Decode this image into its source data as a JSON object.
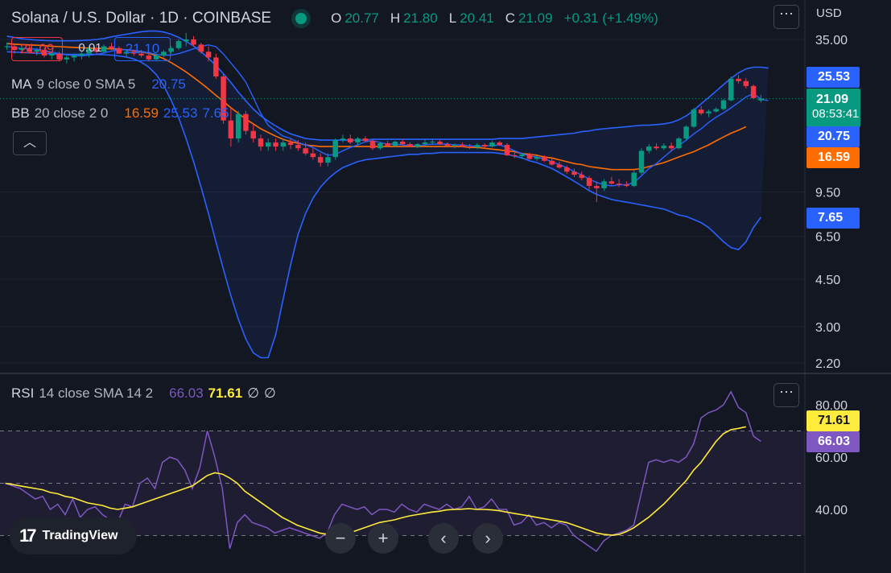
{
  "header": {
    "title": "Solana / U.S. Dollar · 1D · COINBASE",
    "ohlc": [
      {
        "k": "O",
        "v": "20.77"
      },
      {
        "k": "H",
        "v": "21.80"
      },
      {
        "k": "L",
        "v": "20.41"
      },
      {
        "k": "C",
        "v": "21.09"
      }
    ],
    "change": "+0.31 (+1.49%)",
    "currency": "USD"
  },
  "sell_price": "21.09",
  "spread": "0.01",
  "buy_price": "21.10",
  "ma_legend": {
    "name": "MA",
    "params": "9 close 0 SMA 5",
    "value": "20.75"
  },
  "bb_legend": {
    "name": "BB",
    "params": "20 close 2 0",
    "basis": "16.59",
    "upper": "25.53",
    "lower": "7.65"
  },
  "rsi_legend": {
    "name": "RSI",
    "params": "14 close SMA 14 2",
    "rsi": "66.03",
    "sma": "71.61",
    "div1": "∅",
    "div2": "∅"
  },
  "axis_tags": {
    "bb_upper": "25.53",
    "last_price": "21.09",
    "countdown": "08:53:41",
    "ma": "20.75",
    "bb_basis": "16.59",
    "bb_lower": "7.65",
    "rsi_sma": "71.61",
    "rsi": "66.03"
  },
  "branding": "TradingView",
  "icons": {
    "menu": "ellipsis-icon",
    "collapse": "chevron-up-icon",
    "zoom_out": "minus-icon",
    "zoom_in": "plus-icon",
    "scroll_left": "chevron-left-icon",
    "scroll_right": "chevron-right-icon"
  },
  "colors": {
    "up": "#089981",
    "down": "#f23645",
    "ma": "#2962ff",
    "bb_basis": "#ff6d00",
    "bb_band": "#2962ff",
    "rsi": "#7e57c2",
    "rsi_sma": "#ffeb3b"
  },
  "chart_data": [
    {
      "type": "candlestick",
      "title": "Solana / U.S. Dollar · 1D · COINBASE",
      "yscale": "log",
      "yticks": [
        35.0,
        9.5,
        6.5,
        4.5,
        3.0,
        2.2
      ],
      "ylim": [
        2.1,
        40
      ],
      "candles": [
        [
          33,
          34,
          32,
          33
        ],
        [
          33,
          33.5,
          31,
          32
        ],
        [
          32,
          33,
          31,
          32.5
        ],
        [
          32.5,
          33,
          31,
          31.5
        ],
        [
          31.5,
          32.5,
          30.5,
          32
        ],
        [
          32,
          32.5,
          30,
          30.5
        ],
        [
          30.5,
          31.5,
          29.5,
          31
        ],
        [
          31,
          31.5,
          29,
          29.5
        ],
        [
          29.5,
          30.5,
          28.5,
          30
        ],
        [
          30,
          31,
          29,
          30.5
        ],
        [
          30.5,
          31.5,
          29.5,
          31
        ],
        [
          31,
          33,
          30,
          32.5
        ],
        [
          32.5,
          33,
          31,
          31.5
        ],
        [
          31.5,
          33.5,
          31,
          33
        ],
        [
          33,
          34,
          32,
          32.5
        ],
        [
          32.5,
          33,
          31,
          31
        ],
        [
          31,
          32,
          30,
          31.5
        ],
        [
          31.5,
          32,
          30.5,
          31
        ],
        [
          31,
          32,
          30,
          30.5
        ],
        [
          30.5,
          31,
          29,
          29.5
        ],
        [
          29.5,
          31,
          29,
          30.5
        ],
        [
          30.5,
          32,
          30,
          31.5
        ],
        [
          31.5,
          33,
          31,
          32.5
        ],
        [
          32.5,
          35,
          32,
          34.5
        ],
        [
          34.5,
          37,
          33,
          35
        ],
        [
          35,
          36,
          33,
          33.5
        ],
        [
          33.5,
          34,
          31,
          31.5
        ],
        [
          31.5,
          33,
          29,
          30
        ],
        [
          30,
          31,
          25,
          25.5
        ],
        [
          25.5,
          26,
          17,
          17.5
        ],
        [
          17.5,
          19.5,
          14,
          15
        ],
        [
          15,
          19,
          14.5,
          18.5
        ],
        [
          18.5,
          19,
          15.5,
          16
        ],
        [
          16,
          17,
          14.5,
          15
        ],
        [
          15,
          15.5,
          13.5,
          14
        ],
        [
          14,
          15,
          13.5,
          14.5
        ],
        [
          14.5,
          15,
          13.5,
          14
        ],
        [
          14,
          15,
          13.5,
          14.5
        ],
        [
          14.5,
          15,
          13.7,
          14.2
        ],
        [
          14.2,
          14.8,
          13.5,
          13.8
        ],
        [
          13.8,
          14.5,
          13,
          13.2
        ],
        [
          13.2,
          13.8,
          12.5,
          12.8
        ],
        [
          12.8,
          13.2,
          11.8,
          12.2
        ],
        [
          12.2,
          13.2,
          11.8,
          12.8
        ],
        [
          12.8,
          15,
          12.5,
          14.8
        ],
        [
          14.8,
          15.5,
          14.5,
          15
        ],
        [
          15,
          15.5,
          14.3,
          14.5
        ],
        [
          14.5,
          15.2,
          14.2,
          15
        ],
        [
          15,
          15.3,
          14.5,
          14.7
        ],
        [
          14.7,
          14.9,
          13.6,
          13.8
        ],
        [
          13.8,
          14.6,
          13.6,
          14.4
        ],
        [
          14.4,
          14.7,
          14,
          14.1
        ],
        [
          14.1,
          14.7,
          14,
          14.6
        ],
        [
          14.6,
          14.9,
          14.2,
          14.3
        ],
        [
          14.3,
          14.5,
          13.9,
          14.0
        ],
        [
          14.0,
          14.4,
          13.8,
          14.3
        ],
        [
          14.3,
          14.8,
          14.1,
          14.5
        ],
        [
          14.5,
          14.8,
          14.2,
          14.6
        ],
        [
          14.6,
          14.8,
          14.2,
          14.3
        ],
        [
          14.3,
          14.5,
          13.9,
          14.1
        ],
        [
          14.1,
          14.4,
          13.8,
          14.2
        ],
        [
          14.2,
          14.5,
          13.9,
          14.0
        ],
        [
          14.0,
          14.3,
          13.7,
          13.9
        ],
        [
          13.9,
          14.4,
          13.7,
          14.2
        ],
        [
          14.2,
          14.4,
          13.9,
          14.0
        ],
        [
          14.0,
          14.7,
          13.9,
          14.5
        ],
        [
          14.5,
          14.7,
          14.1,
          14.2
        ],
        [
          14.2,
          14.4,
          12.9,
          13.0
        ],
        [
          13.0,
          13.3,
          12.7,
          12.9
        ],
        [
          12.9,
          13.2,
          12.6,
          13.1
        ],
        [
          13.1,
          13.3,
          12.5,
          12.6
        ],
        [
          12.6,
          12.9,
          12.4,
          12.8
        ],
        [
          12.8,
          13.0,
          12.3,
          12.4
        ],
        [
          12.4,
          12.7,
          11.9,
          12.0
        ],
        [
          12.0,
          12.3,
          11.6,
          11.7
        ],
        [
          11.7,
          11.9,
          11.1,
          11.3
        ],
        [
          11.3,
          11.6,
          10.8,
          11.0
        ],
        [
          11.0,
          11.3,
          10.5,
          10.7
        ],
        [
          10.7,
          10.9,
          9.7,
          10.0
        ],
        [
          10.0,
          10.4,
          8.7,
          9.8
        ],
        [
          9.8,
          10.6,
          9.6,
          10.4
        ],
        [
          10.4,
          10.8,
          10.1,
          10.2
        ],
        [
          10.2,
          10.6,
          9.9,
          10.1
        ],
        [
          10.1,
          10.4,
          9.9,
          10.0
        ],
        [
          10.0,
          11.4,
          9.9,
          11.2
        ],
        [
          11.2,
          13.8,
          11.0,
          13.5
        ],
        [
          13.5,
          14.3,
          13.2,
          14.0
        ],
        [
          14.0,
          14.4,
          13.6,
          13.8
        ],
        [
          13.8,
          14.4,
          13.6,
          14.1
        ],
        [
          14.1,
          14.5,
          13.5,
          13.8
        ],
        [
          13.8,
          15.2,
          13.7,
          15.0
        ],
        [
          15.0,
          16.8,
          14.8,
          16.6
        ],
        [
          16.6,
          19.5,
          16.4,
          19.2
        ],
        [
          19.2,
          19.8,
          18.3,
          18.6
        ],
        [
          18.6,
          19.2,
          18.0,
          18.9
        ],
        [
          18.9,
          19.6,
          18.7,
          19.3
        ],
        [
          19.3,
          21.0,
          19.1,
          20.8
        ],
        [
          20.8,
          25.5,
          20.6,
          25.0
        ],
        [
          25.0,
          25.8,
          24.0,
          24.5
        ],
        [
          24.5,
          25.1,
          23.0,
          23.5
        ],
        [
          23.5,
          23.8,
          21.0,
          21.2
        ],
        [
          20.77,
          21.8,
          20.41,
          21.09
        ]
      ],
      "ma": [
        33,
        32.6,
        32.4,
        32.3,
        32.2,
        31.8,
        31.4,
        31.0,
        30.7,
        30.5,
        30.4,
        30.6,
        30.8,
        31.2,
        31.7,
        32.0,
        32.1,
        31.9,
        31.6,
        31.2,
        30.8,
        30.6,
        30.6,
        31.0,
        31.6,
        32.3,
        33.0,
        33.4,
        32.9,
        30.9,
        28.6,
        26.5,
        24.3,
        21.3,
        18.6,
        16.8,
        16.0,
        15.3,
        15.0,
        14.5,
        14.2,
        13.9,
        13.4,
        13.0,
        13.1,
        13.5,
        13.9,
        14.2,
        14.6,
        14.7,
        14.5,
        14.3,
        14.3,
        14.2,
        14.1,
        14.1,
        14.2,
        14.3,
        14.3,
        14.3,
        14.2,
        14.2,
        14.1,
        14.0,
        14.1,
        14.1,
        14.2,
        13.9,
        13.5,
        13.2,
        12.9,
        12.8,
        12.6,
        12.3,
        12.0,
        11.7,
        11.3,
        11.0,
        10.6,
        10.3,
        10.1,
        10.0,
        10.1,
        10.1,
        10.3,
        10.9,
        11.6,
        12.1,
        12.8,
        13.5,
        14.1,
        14.8,
        15.6,
        16.3,
        17.2,
        18.0,
        18.7,
        19.5,
        20.4,
        21.4,
        22.0,
        21.0,
        20.75
      ],
      "bb_upper": [
        36,
        35.6,
        35.2,
        35,
        34.8,
        34.7,
        34.6,
        34.6,
        34.6,
        34.6,
        34.7,
        34.8,
        35.0,
        35.3,
        35.8,
        36.2,
        36.6,
        37.0,
        37.4,
        37.6,
        37.6,
        37.3,
        36.6,
        35.6,
        34.4,
        33.1,
        31.5,
        29.8,
        28.0,
        26.1,
        24.2,
        22.3,
        20.7,
        19.3,
        18.2,
        17.4,
        16.7,
        16.1,
        15.6,
        15.3,
        15.0,
        14.9,
        14.8,
        14.8,
        14.8,
        14.8,
        14.8,
        14.8,
        14.8,
        14.9,
        14.9,
        14.9,
        14.9,
        14.9,
        14.9,
        14.9,
        14.9,
        14.9,
        14.9,
        14.9,
        14.9,
        14.9,
        14.9,
        14.9,
        14.9,
        14.9,
        15.0,
        15.0,
        15.0,
        15.0,
        15.1,
        15.2,
        15.3,
        15.4,
        15.5,
        15.6,
        15.7,
        15.9,
        16.0,
        16.2,
        16.3,
        16.4,
        16.5,
        16.6,
        16.7,
        16.8,
        16.8,
        16.9,
        17.0,
        17.2,
        17.6,
        18.2,
        19.1,
        20.2,
        21.3,
        22.5,
        23.8,
        25.1,
        26.3,
        27.2,
        27.6,
        27.6,
        27.4
      ],
      "bb_lower": [
        31.5,
        31.4,
        31.3,
        31.2,
        31.1,
        31.0,
        30.9,
        30.8,
        30.8,
        30.8,
        30.8,
        30.8,
        30.8,
        30.7,
        30.6,
        30.4,
        30.1,
        29.6,
        28.8,
        27.6,
        25.9,
        23.6,
        20.8,
        17.9,
        15.0,
        12.3,
        9.9,
        7.9,
        6.2,
        4.9,
        3.9,
        3.2,
        2.7,
        2.4,
        2.3,
        2.3,
        2.8,
        3.8,
        5.1,
        6.6,
        7.9,
        9.0,
        9.9,
        10.6,
        11.2,
        11.7,
        12.0,
        12.3,
        12.5,
        12.6,
        12.7,
        12.8,
        12.9,
        13.0,
        13.1,
        13.1,
        13.2,
        13.2,
        13.3,
        13.3,
        13.3,
        13.3,
        13.3,
        13.3,
        13.3,
        13.3,
        13.2,
        13.1,
        12.9,
        12.7,
        12.4,
        12.2,
        11.9,
        11.6,
        11.2,
        10.8,
        10.4,
        10.0,
        9.6,
        9.3,
        9.1,
        8.9,
        8.8,
        8.7,
        8.6,
        8.5,
        8.4,
        8.3,
        8.2,
        8.0,
        7.8,
        7.7,
        7.5,
        7.3,
        7.0,
        6.6,
        6.2,
        5.9,
        5.8,
        6.2,
        7.0,
        7.65
      ],
      "bb_basis": [
        33.8,
        33.6,
        33.5,
        33.4,
        33.3,
        33.2,
        33.0,
        32.9,
        32.8,
        32.7,
        32.6,
        32.5,
        32.4,
        32.4,
        32.3,
        32.2,
        32.0,
        31.8,
        31.5,
        31.1,
        30.5,
        29.7,
        28.7,
        27.6,
        26.5,
        25.3,
        24.1,
        22.9,
        21.7,
        20.6,
        19.5,
        18.6,
        17.7,
        17.0,
        16.3,
        15.8,
        15.3,
        14.9,
        14.6,
        14.4,
        14.2,
        14.1,
        14.0,
        14.0,
        14.0,
        14.0,
        14.0,
        14.0,
        14.0,
        14.0,
        14.0,
        14.0,
        14.0,
        14.0,
        14.0,
        14.0,
        14.0,
        14.0,
        14.0,
        14.0,
        14.0,
        14.0,
        13.9,
        13.9,
        13.8,
        13.7,
        13.6,
        13.5,
        13.4,
        13.2,
        13.1,
        13.0,
        12.8,
        12.7,
        12.5,
        12.3,
        12.1,
        12.0,
        11.8,
        11.7,
        11.6,
        11.5,
        11.5,
        11.5,
        11.5,
        11.6,
        11.8,
        12.0,
        12.2,
        12.5,
        12.8,
        13.1,
        13.4,
        13.8,
        14.2,
        14.7,
        15.2,
        15.7,
        16.1,
        16.59
      ]
    },
    {
      "type": "line",
      "title": "RSI 14 close SMA 14 2",
      "yticks": [
        80.0,
        60.0,
        40.0
      ],
      "ylim": [
        20,
        90
      ],
      "bands": [
        70,
        50,
        30
      ],
      "rsi": [
        50,
        49,
        48,
        46,
        44,
        45,
        40,
        42,
        38,
        44,
        37,
        40,
        41,
        38,
        36,
        35,
        42,
        41,
        50,
        52,
        48,
        58,
        60,
        59,
        55,
        48,
        56,
        70,
        60,
        48,
        25,
        35,
        38,
        35,
        34,
        33,
        31,
        32,
        33,
        32,
        31,
        30,
        29,
        31,
        38,
        42,
        41,
        40,
        41,
        38,
        40,
        40,
        39,
        42,
        40,
        39,
        42,
        41,
        40,
        42,
        40,
        41,
        45,
        40,
        41,
        44,
        40,
        40,
        34,
        35,
        38,
        34,
        35,
        33,
        35,
        34,
        30,
        28,
        26,
        24,
        28,
        30,
        31,
        32,
        34,
        46,
        58,
        59,
        58,
        59,
        58,
        60,
        65,
        75,
        77,
        78,
        80,
        85,
        79,
        77,
        68,
        66.03
      ],
      "rsi_sma": [
        50,
        49.5,
        49,
        48.5,
        48,
        47.5,
        46.5,
        46,
        45,
        44.5,
        43.5,
        42.5,
        42,
        41.5,
        40.5,
        40,
        40.5,
        41,
        42,
        43,
        44,
        45,
        46,
        47,
        48,
        49,
        51,
        53,
        54,
        53.5,
        52,
        50,
        47,
        45,
        43,
        41,
        39,
        37,
        35.5,
        34,
        33,
        32,
        31,
        30.5,
        30.2,
        30.5,
        31,
        32,
        33,
        34,
        35,
        35.5,
        36,
        36.8,
        37.5,
        38,
        38.5,
        39,
        39.3,
        39.8,
        40,
        40.1,
        40.3,
        40,
        40,
        39.8,
        39.5,
        39,
        38.5,
        38,
        37.5,
        37,
        36.5,
        36,
        35.5,
        35,
        34,
        33,
        32,
        31,
        30.5,
        30.2,
        30.4,
        31.5,
        33,
        35,
        37,
        39.5,
        42,
        45,
        48,
        51,
        55,
        58,
        62,
        66,
        69,
        70.5,
        71,
        71.61
      ]
    }
  ]
}
